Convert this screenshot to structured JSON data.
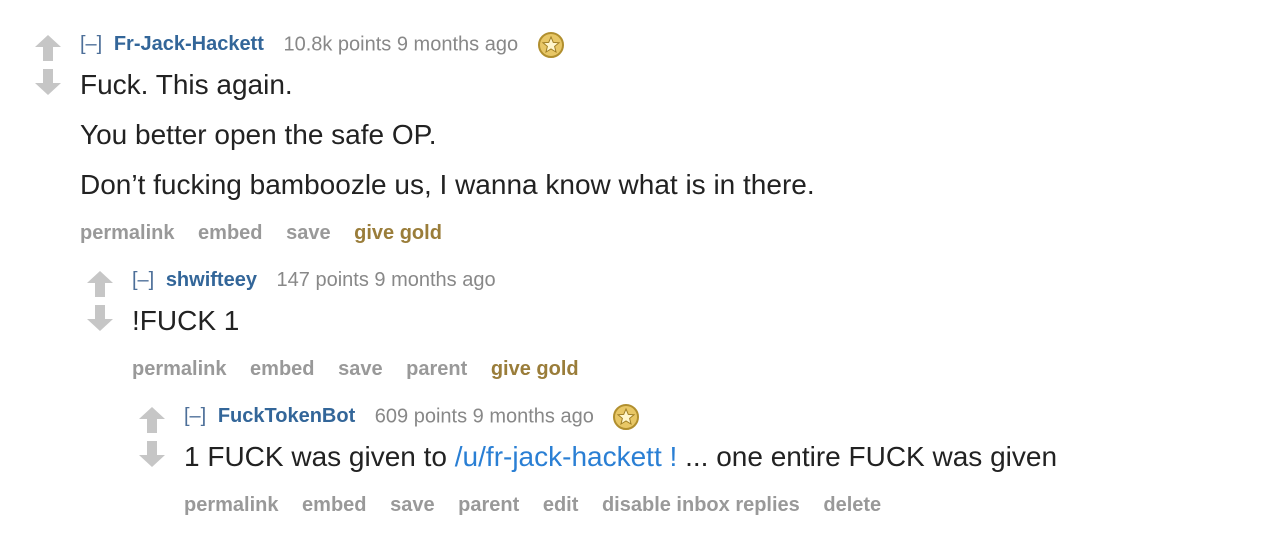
{
  "comments": [
    {
      "toggle": "[–]",
      "author": "Fr-Jack-Hackett",
      "score": "10.8k points",
      "age": "9 months ago",
      "body": [
        "Fuck. This again.",
        "You better open the safe OP.",
        "Don’t fucking bamboozle us, I wanna know what is in there."
      ],
      "buttons": [
        "permalink",
        "embed",
        "save",
        "give gold"
      ]
    },
    {
      "toggle": "[–]",
      "author": "shwifteey",
      "score": "147 points",
      "age": "9 months ago",
      "body": [
        "!FUCK 1"
      ],
      "buttons": [
        "permalink",
        "embed",
        "save",
        "parent",
        "give gold"
      ]
    },
    {
      "toggle": "[–]",
      "author": "FuckTokenBot",
      "score": "609 points",
      "age": "9 months ago",
      "body_pre": "1 FUCK was given to ",
      "body_link": "/u/fr-jack-hackett !",
      "body_post": " ... one entire FUCK was given",
      "buttons": [
        "permalink",
        "embed",
        "save",
        "parent",
        "edit",
        "disable inbox replies",
        "delete"
      ]
    }
  ],
  "colors": {
    "author": "#336699",
    "link": "#2a7fd4",
    "gold": "#9a7d3a",
    "muted": "#888888",
    "arrow": "#c6c6c6"
  },
  "icons": [
    "upvote-arrow-icon",
    "downvote-arrow-icon",
    "gilded-star-icon"
  ]
}
